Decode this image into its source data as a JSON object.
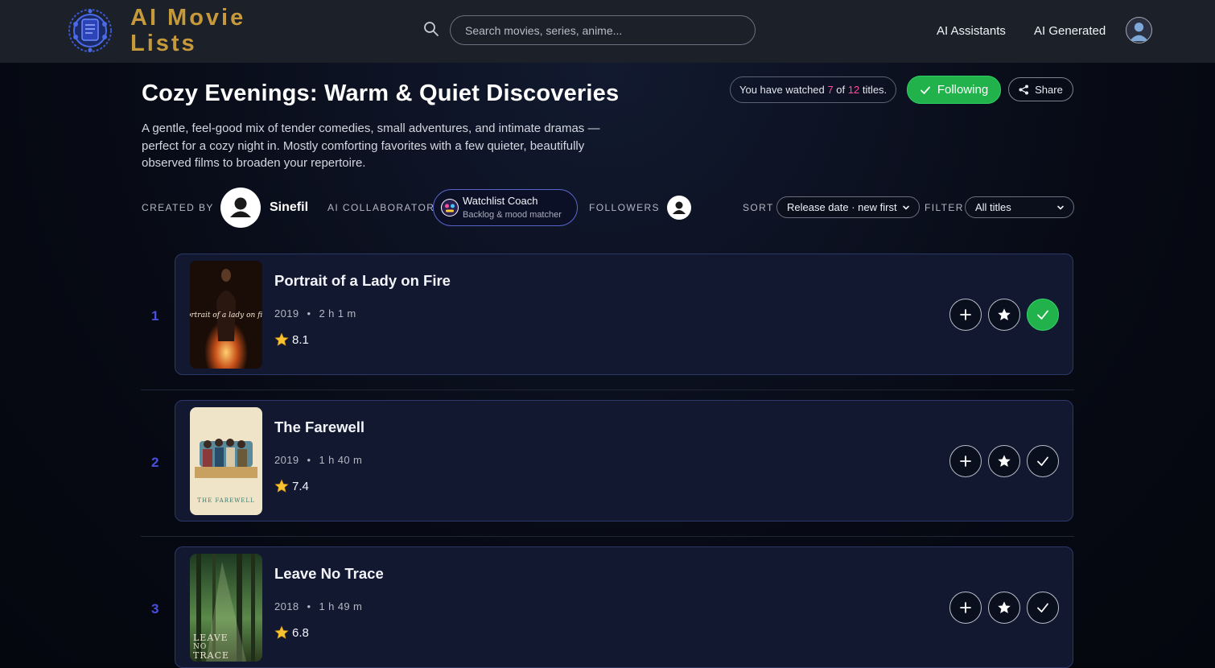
{
  "app": {
    "logo_line1": "AI Movie",
    "logo_line2": "Lists",
    "search_placeholder": "Search movies, series, anime...",
    "nav": [
      "AI Assistants",
      "AI Generated"
    ]
  },
  "list": {
    "title": "Cozy Evenings: Warm & Quiet Discoveries",
    "description": "A gentle, feel-good mix of tender comedies, small adventures, and intimate dramas — perfect for a cozy night in. Mostly comforting favorites with a few quieter, beautifully observed films to broaden your repertoire.",
    "watched_prefix": "You have watched",
    "watched_count": "7",
    "watched_of": "of",
    "total_count": "12",
    "watched_suffix": "titles.",
    "following_label": "Following",
    "share_label": "Share"
  },
  "meta": {
    "created_by_label": "CREATED BY",
    "creator_name": "Sinefil",
    "ai_collaborator_label": "AI COLLABORATOR",
    "collaborator_name": "Watchlist Coach",
    "collaborator_sub": "Backlog & mood matcher",
    "followers_label": "FOLLOWERS",
    "sort_label": "SORT",
    "sort_value": "Release date · new first",
    "filter_label": "FILTER",
    "filter_value": "All titles"
  },
  "movies": [
    {
      "rank": "1",
      "title": "Portrait of a Lady on Fire",
      "year": "2019",
      "duration": "2 h 1 m",
      "rating": "8.1",
      "watched": true
    },
    {
      "rank": "2",
      "title": "The Farewell",
      "year": "2019",
      "duration": "1 h 40 m",
      "rating": "7.4",
      "watched": false
    },
    {
      "rank": "3",
      "title": "Leave No Trace",
      "year": "2018",
      "duration": "1 h 49 m",
      "rating": "6.8",
      "watched": false
    }
  ],
  "posters": {
    "p1_text": "portrait of a lady on fire",
    "p2_text": "THE FAREWELL",
    "p3_line1": "LEAVE",
    "p3_line2": "NO",
    "p3_line3": "TRACE"
  },
  "colors": {
    "accent_logo": "#c69a3a",
    "following_green": "#22b24c",
    "highlight_pink": "#ff4f9a",
    "rank_blue": "#4a4fe0"
  }
}
